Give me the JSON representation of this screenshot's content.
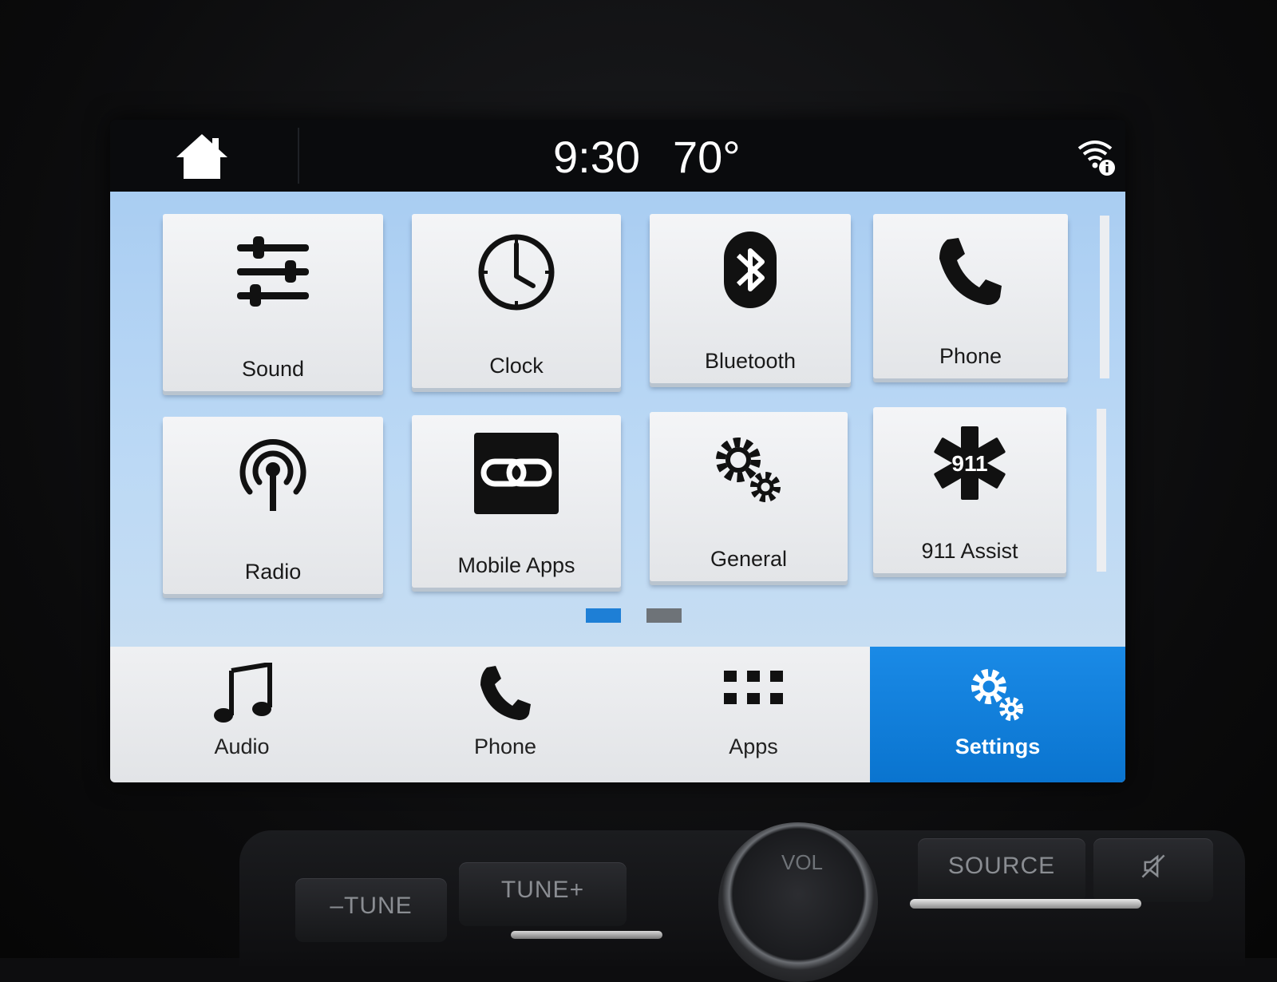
{
  "status_bar": {
    "time": "9:30",
    "temperature": "70°"
  },
  "tiles": [
    {
      "label": "Sound",
      "icon": "sliders-icon"
    },
    {
      "label": "Clock",
      "icon": "clock-icon"
    },
    {
      "label": "Bluetooth",
      "icon": "bluetooth-icon"
    },
    {
      "label": "Phone",
      "icon": "phone-icon"
    },
    {
      "label": "Radio",
      "icon": "radio-antenna-icon"
    },
    {
      "label": "Mobile Apps",
      "icon": "link-icon"
    },
    {
      "label": "General",
      "icon": "gears-icon"
    },
    {
      "label": "911 Assist",
      "icon": "star-of-life-icon",
      "icon_text": "911"
    }
  ],
  "pagination": {
    "current_page": 1,
    "total_pages": 2,
    "active_color": "#1e7fd6",
    "inactive_color": "#6e7378"
  },
  "nav": [
    {
      "label": "Audio",
      "icon": "music-note-icon"
    },
    {
      "label": "Phone",
      "icon": "phone-icon"
    },
    {
      "label": "Apps",
      "icon": "grid-icon"
    },
    {
      "label": "Settings",
      "icon": "gears-icon",
      "active": true
    }
  ],
  "colors": {
    "accent": "#0a74cf",
    "grid_background": "#b6d6f4"
  },
  "physical_controls": {
    "tune_minus": "–TUNE",
    "tune_plus": "TUNE+",
    "source": "SOURCE",
    "volume": "VOL"
  }
}
